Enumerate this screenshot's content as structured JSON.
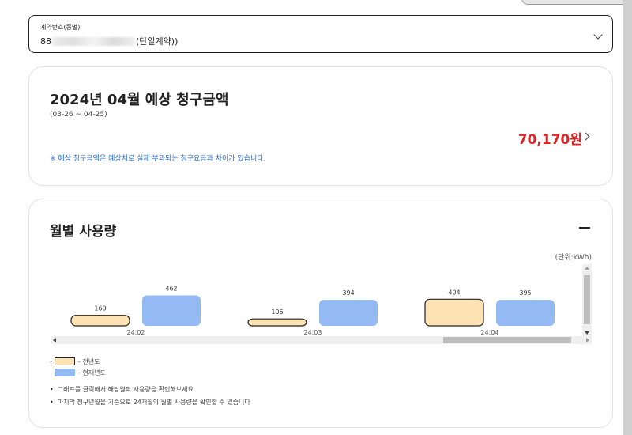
{
  "contract": {
    "label": "계약번호(종별)",
    "value_prefix": "88",
    "value_suffix": "(단일계약))"
  },
  "bill": {
    "title": "2024년 04월 예상 청구금액",
    "period": "(03-26 ~ 04-25)",
    "amount": "70,170원",
    "note": "※ 예상 청구금액은 예상치로 실제 부과되는 청구요금과 차이가 있습니다."
  },
  "usage": {
    "title": "월별 사용량",
    "unit": "(단위:kWh)"
  },
  "legend": {
    "previous_year": "- 전년도",
    "current_year": "- 현재년도"
  },
  "notes": [
    "그래프를 클릭해서 해당월의 사용량을 확인해보세요",
    "마지막 청구년월을 기준으로 24개월의 월별 사용량을 확인할 수 있습니다"
  ],
  "colors": {
    "previous_fill": "#fde2b3",
    "previous_stroke": "#222222",
    "current_fill": "#94b9f3",
    "amount": "#e02424",
    "note": "#2f6fd0"
  },
  "chart_data": {
    "type": "bar",
    "categories": [
      "24.02",
      "24.03",
      "24.04"
    ],
    "series": [
      {
        "values": [
          160,
          106,
          404
        ]
      },
      {
        "values": [
          462,
          394,
          395
        ]
      }
    ],
    "title": "",
    "xlabel": "",
    "ylabel": "",
    "unit": "kWh",
    "ylim": [
      0,
      480
    ],
    "grid": false,
    "legend_placement": "bottom-left"
  }
}
